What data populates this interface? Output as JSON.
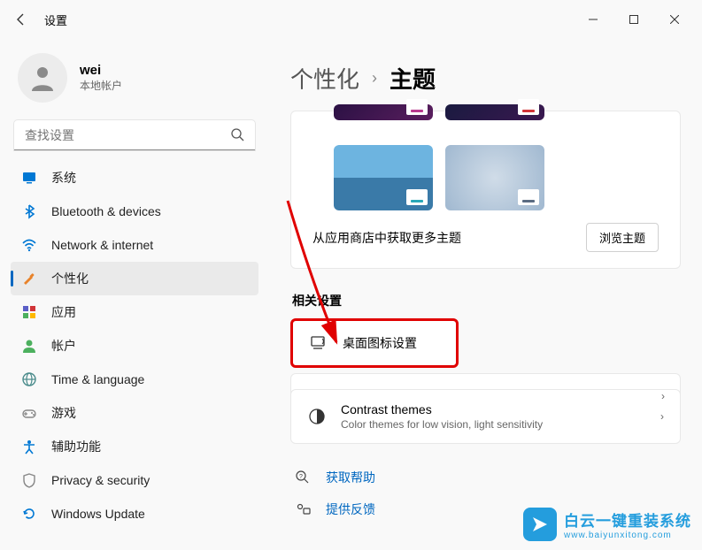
{
  "window_title": "设置",
  "user": {
    "name": "wei",
    "subtitle": "本地帐户"
  },
  "search": {
    "placeholder": "查找设置"
  },
  "nav": [
    {
      "label": "系统",
      "icon": "monitor",
      "color": "#0078d4"
    },
    {
      "label": "Bluetooth & devices",
      "icon": "bluetooth",
      "color": "#0078d4"
    },
    {
      "label": "Network & internet",
      "icon": "wifi",
      "color": "#0078d4"
    },
    {
      "label": "个性化",
      "icon": "brush",
      "color": "#e8832b",
      "selected": true
    },
    {
      "label": "应用",
      "icon": "apps",
      "color": "#5b5fc7"
    },
    {
      "label": "帐户",
      "icon": "person",
      "color": "#4cb05e"
    },
    {
      "label": "Time & language",
      "icon": "globe",
      "color": "#4a8b8b"
    },
    {
      "label": "游戏",
      "icon": "game",
      "color": "#888"
    },
    {
      "label": "辅助功能",
      "icon": "accessibility",
      "color": "#0078d4"
    },
    {
      "label": "Privacy & security",
      "icon": "shield",
      "color": "#888"
    },
    {
      "label": "Windows Update",
      "icon": "update",
      "color": "#0078d4"
    }
  ],
  "breadcrumb": {
    "parent": "个性化",
    "current": "主题"
  },
  "theme_accents": [
    "#b93a8e",
    "#d13438",
    "#2aa8b8",
    "#5a6b82"
  ],
  "more_themes_text": "从应用商店中获取更多主题",
  "browse_button": "浏览主题",
  "related_section_title": "相关设置",
  "desktop_icons": {
    "label": "桌面图标设置"
  },
  "contrast": {
    "label": "Contrast themes",
    "sub": "Color themes for low vision, light sensitivity"
  },
  "help_link": "获取帮助",
  "feedback_link": "提供反馈",
  "watermark": {
    "main": "白云一键重装系统",
    "url": "www.baiyunxitong.com"
  }
}
